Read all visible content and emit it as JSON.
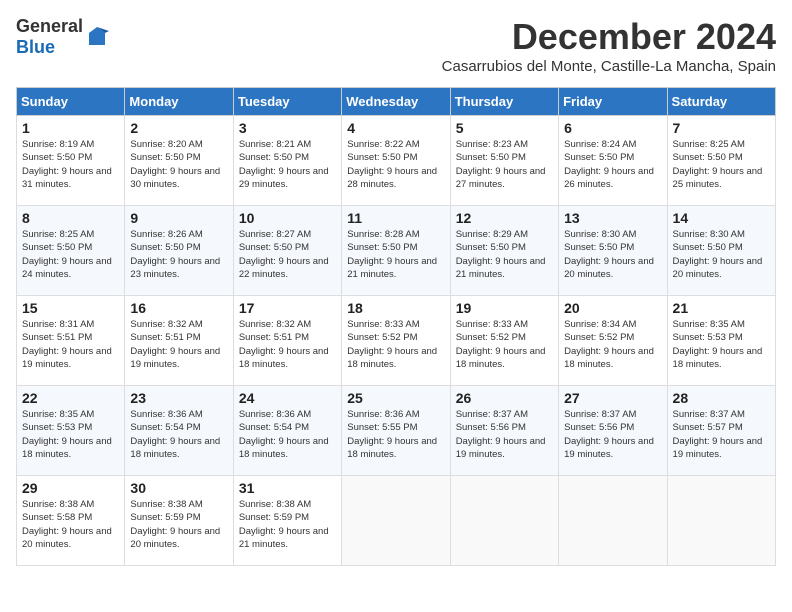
{
  "header": {
    "logo_general": "General",
    "logo_blue": "Blue",
    "month_title": "December 2024",
    "location": "Casarrubios del Monte, Castille-La Mancha, Spain"
  },
  "calendar": {
    "days_of_week": [
      "Sunday",
      "Monday",
      "Tuesday",
      "Wednesday",
      "Thursday",
      "Friday",
      "Saturday"
    ],
    "weeks": [
      [
        {
          "day": "",
          "info": ""
        },
        {
          "day": "",
          "info": ""
        },
        {
          "day": "",
          "info": ""
        },
        {
          "day": "",
          "info": ""
        },
        {
          "day": "",
          "info": ""
        },
        {
          "day": "",
          "info": ""
        },
        {
          "day": "",
          "info": ""
        }
      ],
      [
        {
          "day": "1",
          "info": "Sunrise: 8:19 AM\nSunset: 5:50 PM\nDaylight: 9 hours\nand 31 minutes."
        },
        {
          "day": "2",
          "info": "Sunrise: 8:20 AM\nSunset: 5:50 PM\nDaylight: 9 hours\nand 30 minutes."
        },
        {
          "day": "3",
          "info": "Sunrise: 8:21 AM\nSunset: 5:50 PM\nDaylight: 9 hours\nand 29 minutes."
        },
        {
          "day": "4",
          "info": "Sunrise: 8:22 AM\nSunset: 5:50 PM\nDaylight: 9 hours\nand 28 minutes."
        },
        {
          "day": "5",
          "info": "Sunrise: 8:23 AM\nSunset: 5:50 PM\nDaylight: 9 hours\nand 27 minutes."
        },
        {
          "day": "6",
          "info": "Sunrise: 8:24 AM\nSunset: 5:50 PM\nDaylight: 9 hours\nand 26 minutes."
        },
        {
          "day": "7",
          "info": "Sunrise: 8:25 AM\nSunset: 5:50 PM\nDaylight: 9 hours\nand 25 minutes."
        }
      ],
      [
        {
          "day": "8",
          "info": "Sunrise: 8:25 AM\nSunset: 5:50 PM\nDaylight: 9 hours\nand 24 minutes."
        },
        {
          "day": "9",
          "info": "Sunrise: 8:26 AM\nSunset: 5:50 PM\nDaylight: 9 hours\nand 23 minutes."
        },
        {
          "day": "10",
          "info": "Sunrise: 8:27 AM\nSunset: 5:50 PM\nDaylight: 9 hours\nand 22 minutes."
        },
        {
          "day": "11",
          "info": "Sunrise: 8:28 AM\nSunset: 5:50 PM\nDaylight: 9 hours\nand 21 minutes."
        },
        {
          "day": "12",
          "info": "Sunrise: 8:29 AM\nSunset: 5:50 PM\nDaylight: 9 hours\nand 21 minutes."
        },
        {
          "day": "13",
          "info": "Sunrise: 8:30 AM\nSunset: 5:50 PM\nDaylight: 9 hours\nand 20 minutes."
        },
        {
          "day": "14",
          "info": "Sunrise: 8:30 AM\nSunset: 5:50 PM\nDaylight: 9 hours\nand 20 minutes."
        }
      ],
      [
        {
          "day": "15",
          "info": "Sunrise: 8:31 AM\nSunset: 5:51 PM\nDaylight: 9 hours\nand 19 minutes."
        },
        {
          "day": "16",
          "info": "Sunrise: 8:32 AM\nSunset: 5:51 PM\nDaylight: 9 hours\nand 19 minutes."
        },
        {
          "day": "17",
          "info": "Sunrise: 8:32 AM\nSunset: 5:51 PM\nDaylight: 9 hours\nand 18 minutes."
        },
        {
          "day": "18",
          "info": "Sunrise: 8:33 AM\nSunset: 5:52 PM\nDaylight: 9 hours\nand 18 minutes."
        },
        {
          "day": "19",
          "info": "Sunrise: 8:33 AM\nSunset: 5:52 PM\nDaylight: 9 hours\nand 18 minutes."
        },
        {
          "day": "20",
          "info": "Sunrise: 8:34 AM\nSunset: 5:52 PM\nDaylight: 9 hours\nand 18 minutes."
        },
        {
          "day": "21",
          "info": "Sunrise: 8:35 AM\nSunset: 5:53 PM\nDaylight: 9 hours\nand 18 minutes."
        }
      ],
      [
        {
          "day": "22",
          "info": "Sunrise: 8:35 AM\nSunset: 5:53 PM\nDaylight: 9 hours\nand 18 minutes."
        },
        {
          "day": "23",
          "info": "Sunrise: 8:36 AM\nSunset: 5:54 PM\nDaylight: 9 hours\nand 18 minutes."
        },
        {
          "day": "24",
          "info": "Sunrise: 8:36 AM\nSunset: 5:54 PM\nDaylight: 9 hours\nand 18 minutes."
        },
        {
          "day": "25",
          "info": "Sunrise: 8:36 AM\nSunset: 5:55 PM\nDaylight: 9 hours\nand 18 minutes."
        },
        {
          "day": "26",
          "info": "Sunrise: 8:37 AM\nSunset: 5:56 PM\nDaylight: 9 hours\nand 19 minutes."
        },
        {
          "day": "27",
          "info": "Sunrise: 8:37 AM\nSunset: 5:56 PM\nDaylight: 9 hours\nand 19 minutes."
        },
        {
          "day": "28",
          "info": "Sunrise: 8:37 AM\nSunset: 5:57 PM\nDaylight: 9 hours\nand 19 minutes."
        }
      ],
      [
        {
          "day": "29",
          "info": "Sunrise: 8:38 AM\nSunset: 5:58 PM\nDaylight: 9 hours\nand 20 minutes."
        },
        {
          "day": "30",
          "info": "Sunrise: 8:38 AM\nSunset: 5:59 PM\nDaylight: 9 hours\nand 20 minutes."
        },
        {
          "day": "31",
          "info": "Sunrise: 8:38 AM\nSunset: 5:59 PM\nDaylight: 9 hours\nand 21 minutes."
        },
        {
          "day": "",
          "info": ""
        },
        {
          "day": "",
          "info": ""
        },
        {
          "day": "",
          "info": ""
        },
        {
          "day": "",
          "info": ""
        }
      ]
    ]
  }
}
